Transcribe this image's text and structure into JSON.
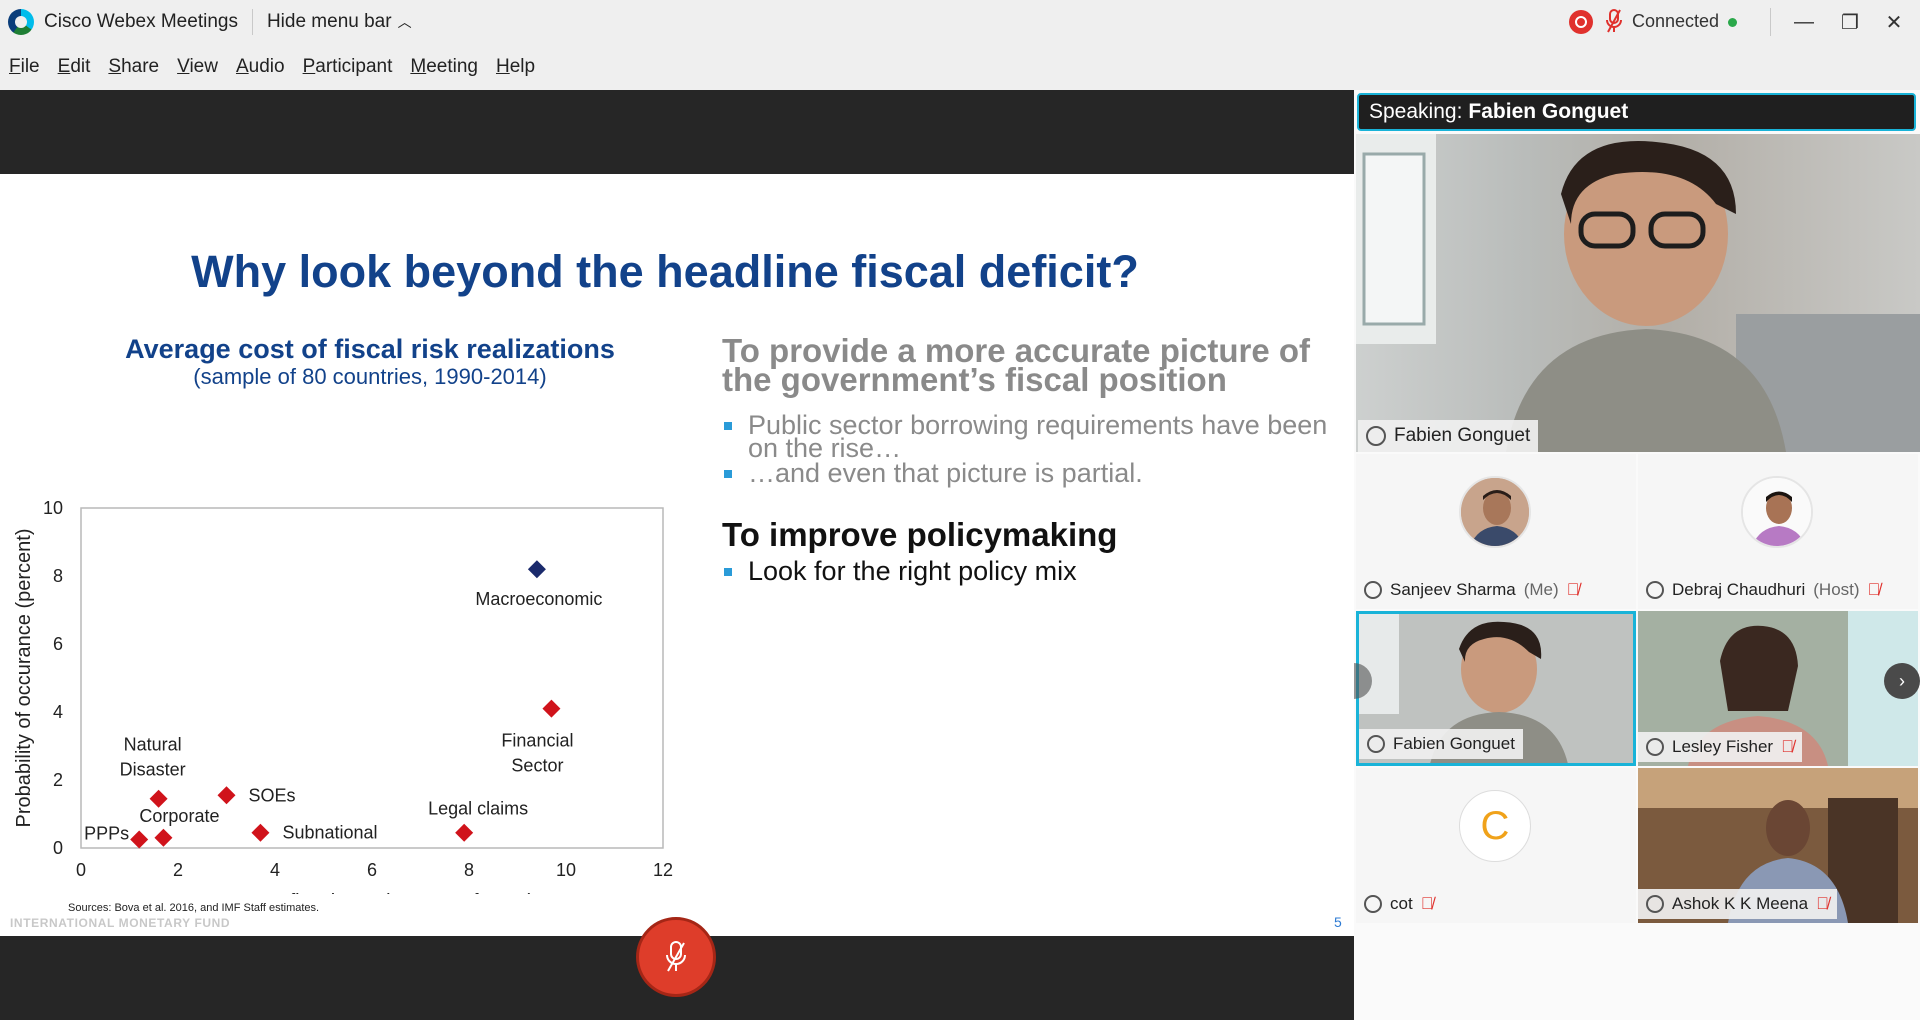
{
  "window": {
    "app_title": "Cisco Webex Meetings",
    "hide_menu": "Hide menu bar",
    "status": "Connected",
    "minimize": "—",
    "restore": "❐",
    "close": "✕"
  },
  "menu": [
    {
      "label": "File",
      "ul": "F",
      "rest": "ile"
    },
    {
      "label": "Edit",
      "ul": "E",
      "rest": "dit"
    },
    {
      "label": "Share",
      "ul": "S",
      "rest": "hare"
    },
    {
      "label": "View",
      "ul": "V",
      "rest": "iew"
    },
    {
      "label": "Audio",
      "ul": "A",
      "rest": "udio"
    },
    {
      "label": "Participant",
      "ul": "P",
      "rest": "articipant"
    },
    {
      "label": "Meeting",
      "ul": "M",
      "rest": "eeting"
    },
    {
      "label": "Help",
      "ul": "H",
      "rest": "elp"
    }
  ],
  "slide": {
    "title": "Why look beyond the headline fiscal deficit?",
    "heading": "To provide a more accurate picture of the government’s fiscal position",
    "bullets": [
      "Public sector borrowing requirements have been on the rise…",
      "…and even that picture is partial."
    ],
    "policy_heading": "To improve policymaking",
    "policy_bullet": "Look for the right policy mix",
    "sources": "Sources: Bova et al. 2016, and IMF Staff estimates.",
    "footer": "INTERNATIONAL MONETARY FUND",
    "number": "5"
  },
  "chart_data": {
    "type": "scatter",
    "title": "Average cost of fiscal risk realizations",
    "subtitle": "(sample of 80 countries, 1990-2014)",
    "xlabel": "Average fiscal cost (percent of GDP)",
    "ylabel": "Probability of occurance (percent)",
    "xlim": [
      0,
      12
    ],
    "ylim": [
      0,
      10
    ],
    "xticks": [
      0,
      2,
      4,
      6,
      8,
      10,
      12
    ],
    "yticks": [
      0,
      2,
      4,
      6,
      8,
      10
    ],
    "points": [
      {
        "label": "Macroeconomic",
        "x": 9.4,
        "y": 8.2,
        "color": "#1a2a6c"
      },
      {
        "label": "Financial Sector",
        "x": 9.7,
        "y": 4.1,
        "color": "#d0131b"
      },
      {
        "label": "Natural Disaster",
        "x": 1.6,
        "y": 1.45,
        "color": "#d0131b"
      },
      {
        "label": "SOEs",
        "x": 3.0,
        "y": 1.55,
        "color": "#d0131b"
      },
      {
        "label": "Corporate",
        "x": 1.7,
        "y": 0.3,
        "color": "#d0131b"
      },
      {
        "label": "PPPs",
        "x": 1.2,
        "y": 0.25,
        "color": "#d0131b"
      },
      {
        "label": "Subnational",
        "x": 3.7,
        "y": 0.45,
        "color": "#d0131b"
      },
      {
        "label": "Legal claims",
        "x": 7.9,
        "y": 0.45,
        "color": "#d0131b"
      }
    ]
  },
  "speaking": {
    "prefix": "Speaking:",
    "name": "Fabien Gonguet"
  },
  "main_video_label": "Fabien Gonguet",
  "participants": [
    {
      "name": "Sanjeev Sharma",
      "role": "(Me)"
    },
    {
      "name": "Debraj Chaudhuri",
      "role": "(Host)"
    },
    {
      "name": "Fabien Gonguet",
      "role": ""
    },
    {
      "name": "Lesley Fisher",
      "role": ""
    },
    {
      "name": "cot",
      "role": "",
      "initial": "C"
    },
    {
      "name": "Ashok K K Meena",
      "role": ""
    }
  ]
}
